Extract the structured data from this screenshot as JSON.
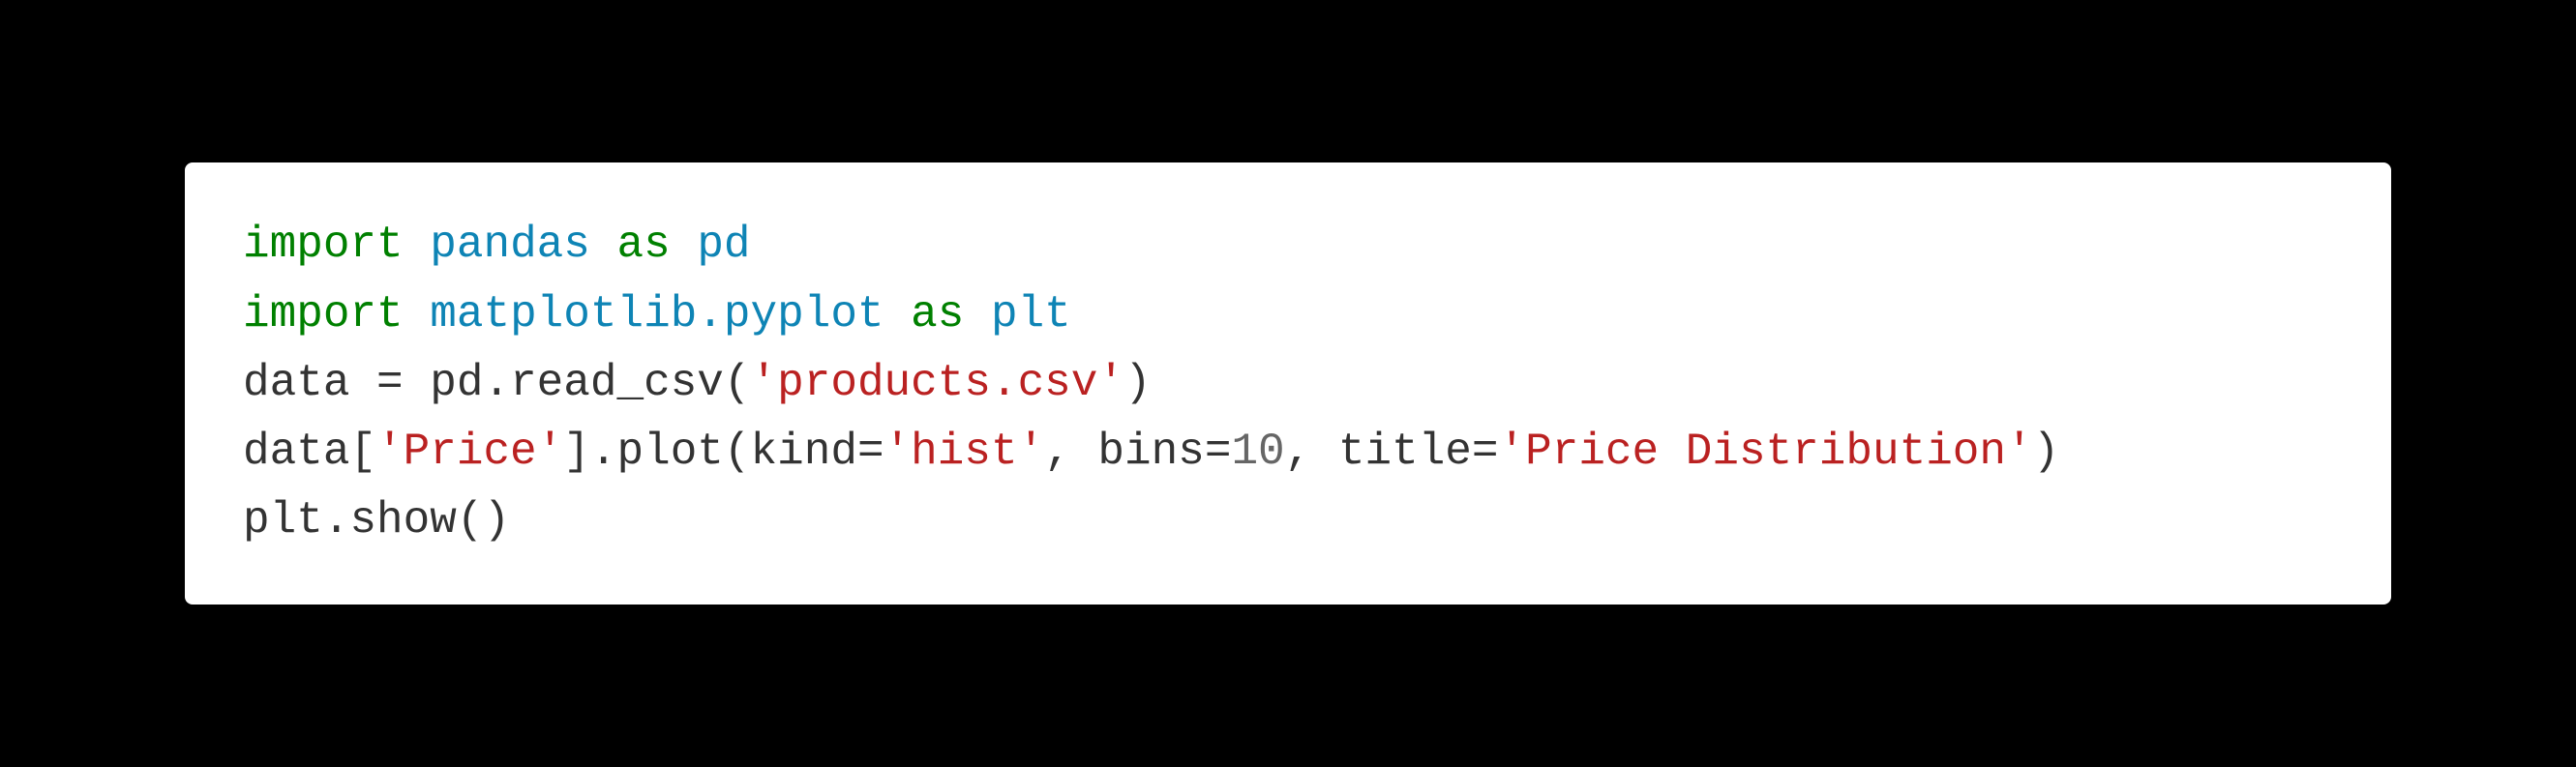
{
  "code": {
    "line1": {
      "kw1": "import",
      "mod1": "pandas",
      "kw2": "as",
      "alias1": "pd"
    },
    "line2": {
      "kw1": "import",
      "mod1": "matplotlib.pyplot",
      "kw2": "as",
      "alias1": "plt"
    },
    "line3": {
      "var": "data ",
      "op": "=",
      "obj": " pd",
      "dot": ".",
      "func": "read_csv",
      "paren1": "(",
      "str1": "'products.csv'",
      "paren2": ")"
    },
    "line4": {
      "var": "data",
      "bracket1": "[",
      "str1": "'Price'",
      "bracket2": "]",
      "dot1": ".",
      "func": "plot",
      "paren1": "(",
      "param1": "kind",
      "eq1": "=",
      "str2": "'hist'",
      "comma1": ", ",
      "param2": "bins",
      "eq2": "=",
      "num1": "10",
      "comma2": ", ",
      "param3": "title",
      "eq3": "=",
      "str3": "'Price Distribution'",
      "paren2": ")"
    },
    "line5": {
      "obj": "plt",
      "dot": ".",
      "func": "show",
      "paren1": "(",
      "paren2": ")"
    }
  }
}
